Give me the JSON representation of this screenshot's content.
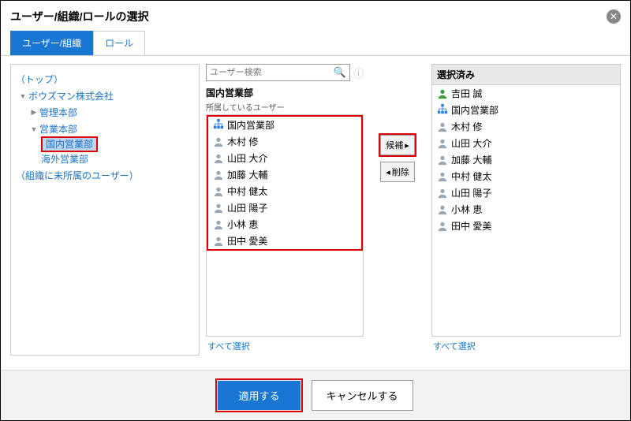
{
  "dialog": {
    "title": "ユーザー/組織/ロールの選択",
    "tabs": {
      "users_orgs": "ユーザー/組織",
      "roles": "ロール"
    }
  },
  "tree": {
    "top": "（トップ）",
    "company": "ボウズマン株式会社",
    "dept1": "管理本部",
    "dept2": "営業本部",
    "dept2a": "国内営業部",
    "dept2b": "海外営業部",
    "unassigned": "（組織に未所属のユーザー）"
  },
  "search": {
    "placeholder": "ユーザー検索"
  },
  "center": {
    "org_title": "国内営業部",
    "sub_label": "所属しているユーザー",
    "items": [
      {
        "type": "org",
        "name": "国内営業部"
      },
      {
        "type": "user",
        "name": "木村 修"
      },
      {
        "type": "user",
        "name": "山田 大介"
      },
      {
        "type": "user",
        "name": "加藤 大輔"
      },
      {
        "type": "user",
        "name": "中村 健太"
      },
      {
        "type": "user",
        "name": "山田 陽子"
      },
      {
        "type": "user",
        "name": "小林 恵"
      },
      {
        "type": "user",
        "name": "田中 愛美"
      }
    ],
    "select_all": "すべて選択"
  },
  "move": {
    "add": "候補",
    "remove": "削除"
  },
  "selected": {
    "title": "選択済み",
    "items": [
      {
        "type": "user",
        "color": "green",
        "name": "吉田 誠"
      },
      {
        "type": "org",
        "name": "国内営業部"
      },
      {
        "type": "user",
        "name": "木村 修"
      },
      {
        "type": "user",
        "name": "山田 大介"
      },
      {
        "type": "user",
        "name": "加藤 大輔"
      },
      {
        "type": "user",
        "name": "中村 健太"
      },
      {
        "type": "user",
        "name": "山田 陽子"
      },
      {
        "type": "user",
        "name": "小林 恵"
      },
      {
        "type": "user",
        "name": "田中 愛美"
      }
    ],
    "select_all": "すべて選択"
  },
  "footer": {
    "apply": "適用する",
    "cancel": "キャンセルする"
  }
}
